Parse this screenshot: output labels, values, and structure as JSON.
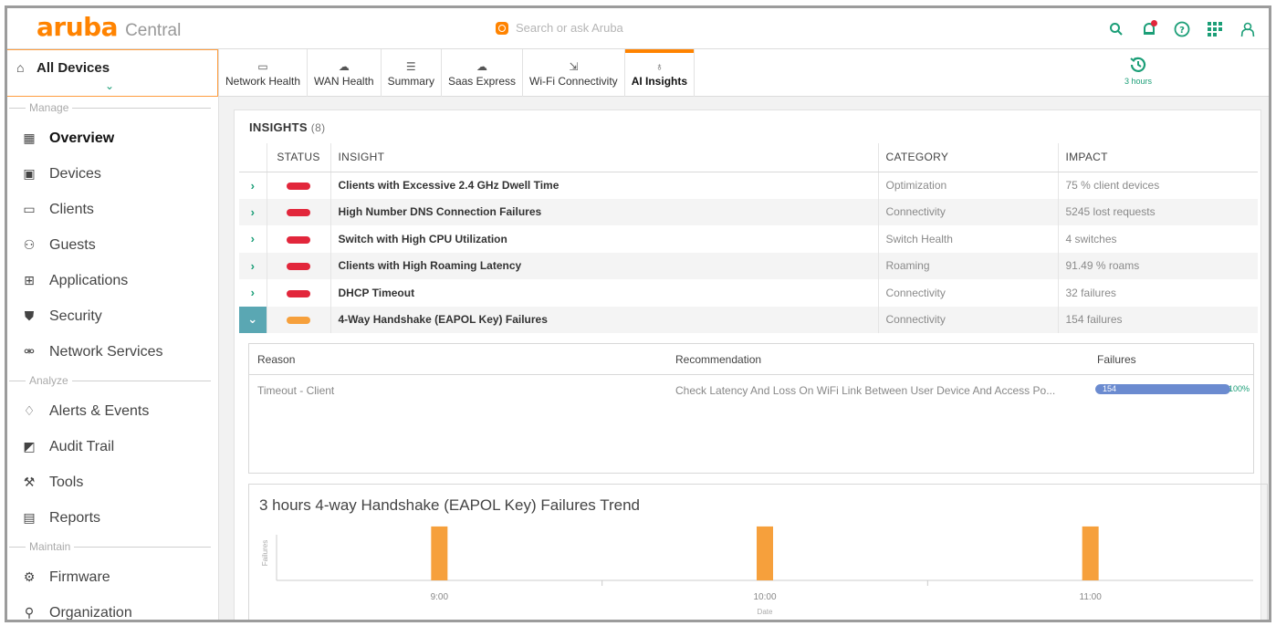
{
  "app": {
    "brand": "aruba",
    "product": "Central"
  },
  "search": {
    "placeholder": "Search or ask Aruba"
  },
  "colors": {
    "accent": "#ff8300",
    "teal": "#1b9e77",
    "critical": "#e2263b",
    "warning": "#f6a03c",
    "bar": "#6b8bd0"
  },
  "header_icons": [
    "search-icon",
    "notification-icon",
    "help-icon",
    "apps-grid-icon",
    "user-icon"
  ],
  "sidebar": {
    "scope": "All Devices",
    "sections": {
      "manage": "Manage",
      "analyze": "Analyze",
      "maintain": "Maintain"
    },
    "items": [
      {
        "label": "Overview",
        "icon": "overview-icon"
      },
      {
        "label": "Devices",
        "icon": "devices-icon"
      },
      {
        "label": "Clients",
        "icon": "clients-icon"
      },
      {
        "label": "Guests",
        "icon": "guests-icon"
      },
      {
        "label": "Applications",
        "icon": "applications-icon"
      },
      {
        "label": "Security",
        "icon": "shield-icon"
      },
      {
        "label": "Network Services",
        "icon": "network-services-icon"
      },
      {
        "label": "Alerts & Events",
        "icon": "bell-icon"
      },
      {
        "label": "Audit Trail",
        "icon": "audit-icon"
      },
      {
        "label": "Tools",
        "icon": "tools-icon"
      },
      {
        "label": "Reports",
        "icon": "reports-icon"
      },
      {
        "label": "Firmware",
        "icon": "firmware-icon"
      },
      {
        "label": "Organization",
        "icon": "organization-icon"
      }
    ]
  },
  "tabs": [
    {
      "label": "Network Health"
    },
    {
      "label": "WAN Health"
    },
    {
      "label": "Summary"
    },
    {
      "label": "Saas Express"
    },
    {
      "label": "Wi-Fi Connectivity"
    },
    {
      "label": "AI Insights"
    }
  ],
  "time_filter": "3 hours",
  "insights": {
    "title": "INSIGHTS",
    "count": "(8)",
    "columns": {
      "status": "STATUS",
      "insight": "INSIGHT",
      "category": "CATEGORY",
      "impact": "IMPACT"
    },
    "rows": [
      {
        "insight": "Clients with Excessive 2.4 GHz Dwell Time",
        "category": "Optimization",
        "impact": "75 % client devices",
        "severity": "critical"
      },
      {
        "insight": "High Number DNS Connection Failures",
        "category": "Connectivity",
        "impact": "5245 lost requests",
        "severity": "critical"
      },
      {
        "insight": "Switch with High CPU Utilization",
        "category": "Switch Health",
        "impact": "4 switches",
        "severity": "critical"
      },
      {
        "insight": "Clients with High Roaming Latency",
        "category": "Roaming",
        "impact": "91.49 % roams",
        "severity": "critical"
      },
      {
        "insight": "DHCP Timeout",
        "category": "Connectivity",
        "impact": "32 failures",
        "severity": "critical"
      },
      {
        "insight": "4-Way Handshake (EAPOL Key) Failures",
        "category": "Connectivity",
        "impact": "154 failures",
        "severity": "warning"
      }
    ]
  },
  "detail": {
    "columns": {
      "reason": "Reason",
      "recommendation": "Recommendation",
      "failures": "Failures"
    },
    "row": {
      "reason": "Timeout - Client",
      "recommendation": "Check Latency And Loss On WiFi Link Between User Device And Access Po...",
      "failures": "154",
      "percent": "100%",
      "fraction": 1.0
    }
  },
  "chart_data": {
    "type": "bar",
    "title": "3 hours 4-way Handshake (EAPOL Key) Failures Trend",
    "xlabel": "Date",
    "ylabel": "Failures",
    "categories": [
      "9:00",
      "10:00",
      "11:00"
    ],
    "series": [
      {
        "values": [
          1,
          1,
          1
        ],
        "color": "#f6a03c"
      }
    ],
    "ylim": [
      0,
      1.1
    ],
    "legend_colors": [
      "#e2263b",
      "#f6a03c",
      "#f7d36b"
    ],
    "grid": false
  }
}
